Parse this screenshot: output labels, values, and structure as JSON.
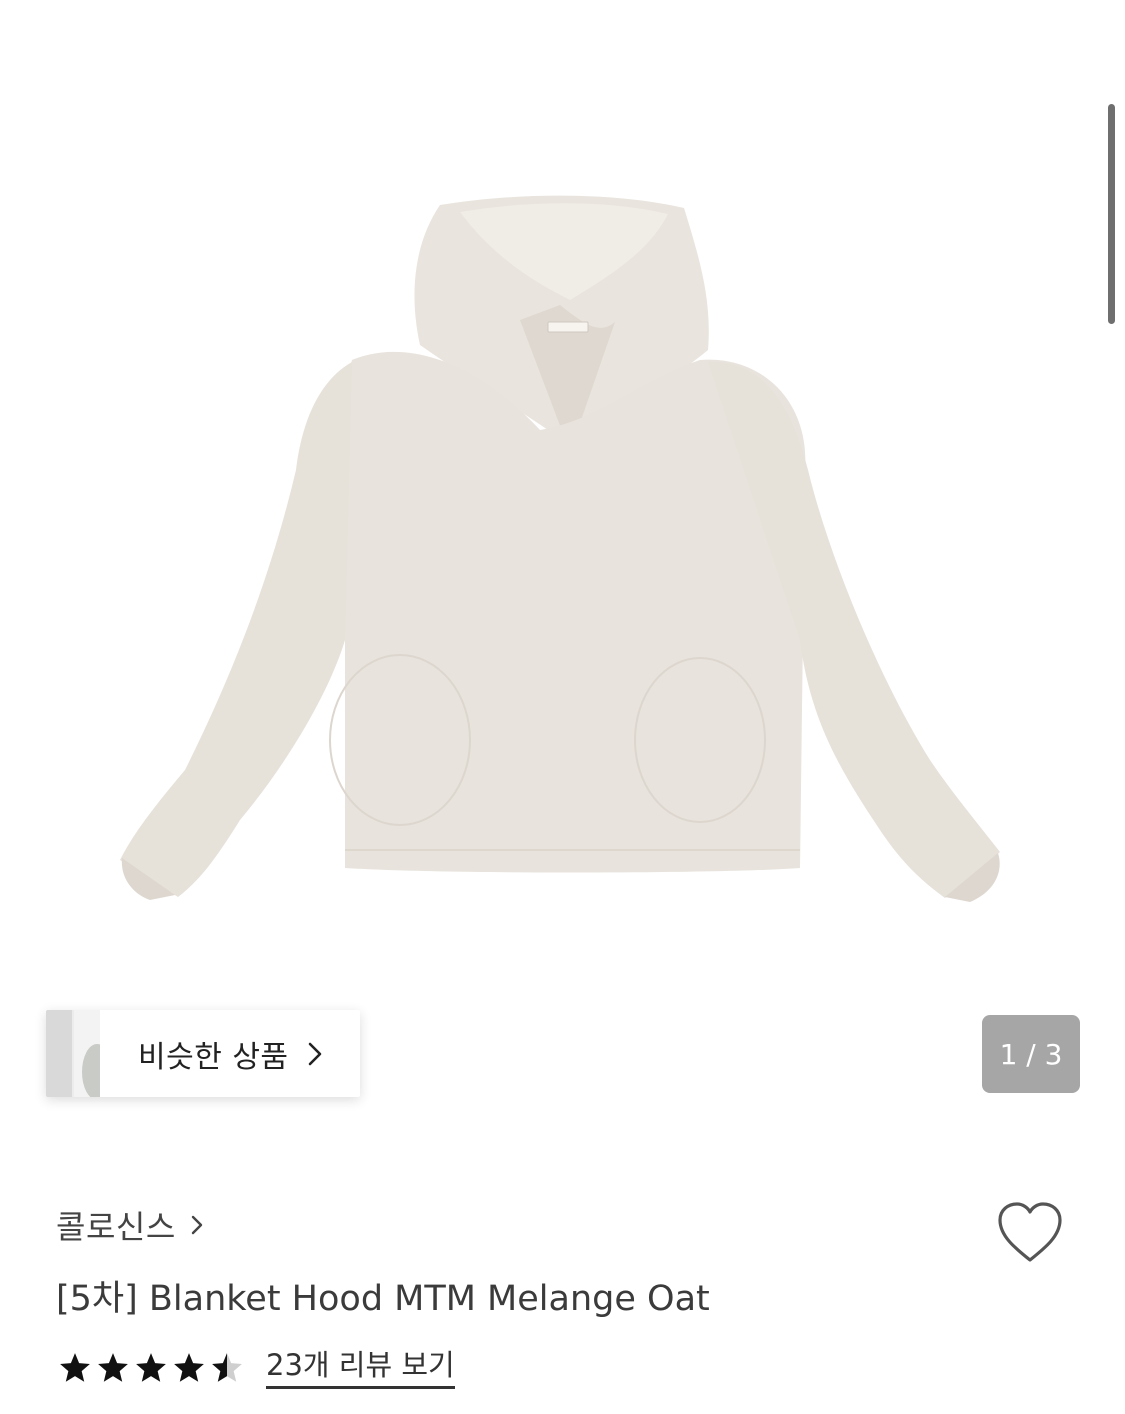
{
  "gallery": {
    "image_alt": "Blanket Hood MTM Melange Oat",
    "product_color": "#e8e3dd",
    "shadow_color": "#d8d2cb",
    "counter_text": "1 / 3"
  },
  "similar": {
    "label": "비슷한 상품",
    "icon": "chevron-right-icon"
  },
  "product": {
    "brand": "콜로신스",
    "title": "[5차] Blanket Hood MTM Melange Oat",
    "rating": 4.5,
    "review_text": "23개 리뷰 보기",
    "wishlist_icon": "heart-outline-icon"
  }
}
